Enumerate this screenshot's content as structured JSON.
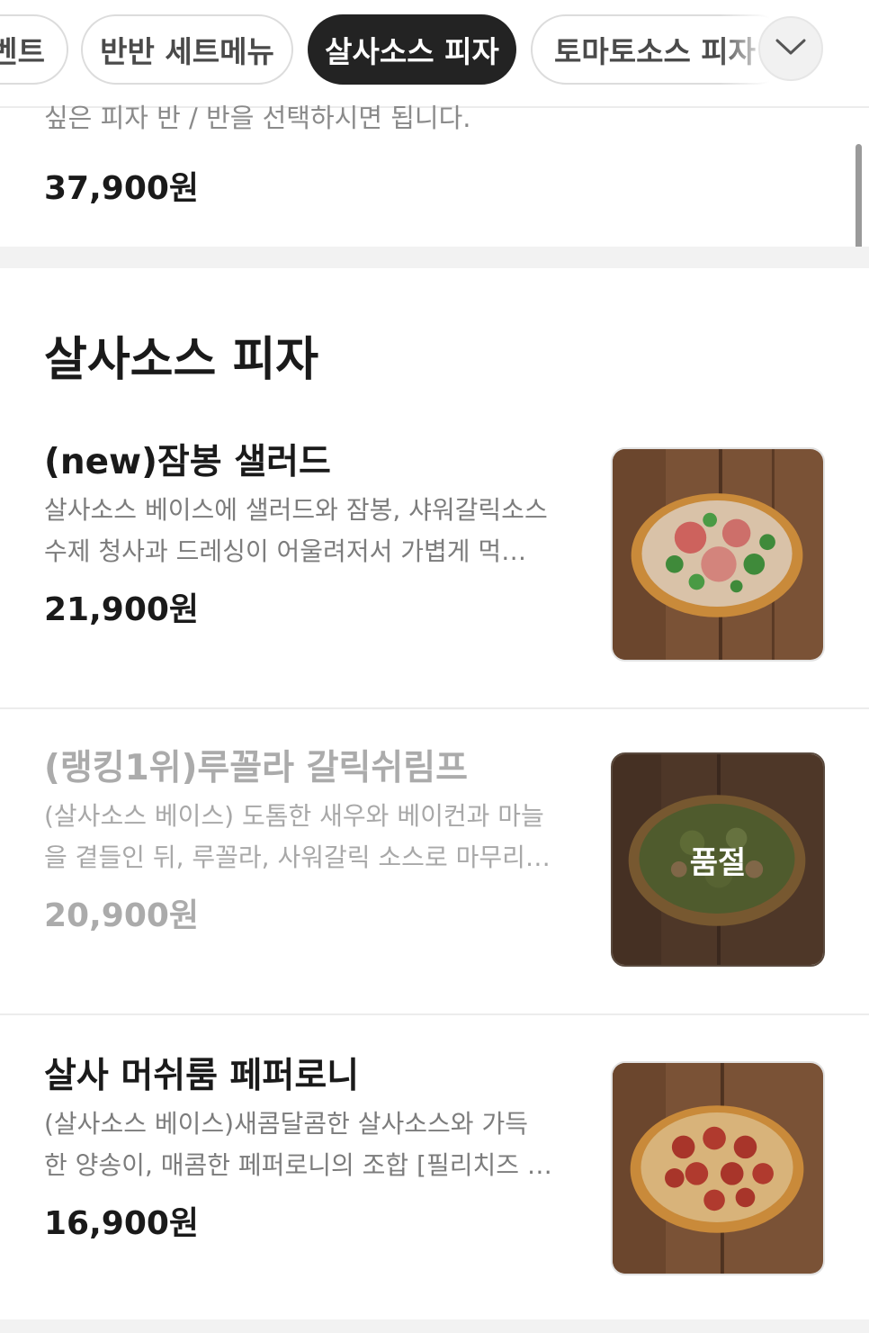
{
  "category_tabs": [
    {
      "label": "벤트",
      "active": false
    },
    {
      "label": "반반 세트메뉴",
      "active": false
    },
    {
      "label": "살사소스 피자",
      "active": true
    },
    {
      "label": "토마토소스 피자",
      "active": false
    }
  ],
  "expand_icon": "chevron-down-icon",
  "previous_item": {
    "description": "싶은 피자 반 / 반을 선택하시면 됩니다.",
    "price": "37,900원"
  },
  "section": {
    "title": "살사소스 피자",
    "items": [
      {
        "name": "(new)잠봉 샐러드",
        "description_line1": "살사소스 베이스에 샐러드와 잠봉, 샤워갈릭소스",
        "description_line2": "수제 청사과 드레싱이 어울려저서 가볍게 먹…",
        "price": "21,900원",
        "sold_out": false
      },
      {
        "name": "(랭킹1위)루꼴라 갈릭쉬림프",
        "description_line1": "(살사소스 베이스) 도톰한 새우와 베이컨과 마늘",
        "description_line2": "을 곁들인 뒤, 루꼴라, 사워갈릭 소스로 마무리…",
        "price": "20,900원",
        "sold_out": true,
        "sold_out_label": "품절"
      },
      {
        "name": "살사 머쉬룸 페퍼로니",
        "description_line1": "(살사소스 베이스)새콤달콤한 살사소스와 가득",
        "description_line2": "한 양송이, 매콤한 페퍼로니의 조합 [필리치즈 …",
        "price": "16,900원",
        "sold_out": false
      }
    ]
  },
  "colors": {
    "active_chip": "#232323",
    "text_primary": "#1a1a1a",
    "text_secondary": "#7c7c7c",
    "disabled_text": "#ababab",
    "divider": "#ececec"
  }
}
